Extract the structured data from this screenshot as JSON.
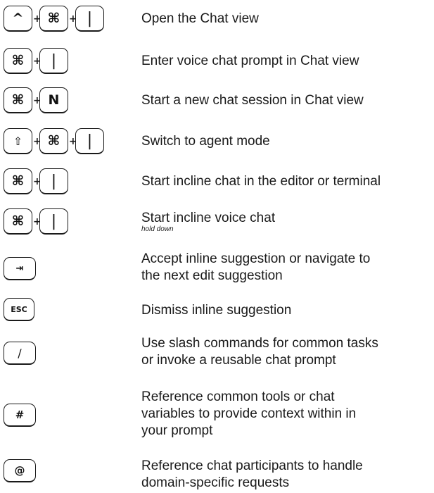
{
  "shortcuts": [
    {
      "keys": [
        "^",
        "⌘",
        "|"
      ],
      "description": "Open the Chat view"
    },
    {
      "keys": [
        "⌘",
        "|"
      ],
      "description": "Enter voice chat prompt in Chat view"
    },
    {
      "keys": [
        "⌘",
        "N"
      ],
      "description": "Start a new chat session in Chat view"
    },
    {
      "keys": [
        "⇧",
        "⌘",
        "|"
      ],
      "description": "Switch to agent mode"
    },
    {
      "keys": [
        "⌘",
        "|"
      ],
      "description": "Start incline chat in the editor or terminal"
    },
    {
      "keys": [
        "⌘",
        "|"
      ],
      "description": "Start incline voice chat",
      "note": "hold down"
    },
    {
      "keys": [
        "⇥"
      ],
      "description_line1": "Accept inline suggestion or navigate to",
      "description_line2": "the next edit suggestion"
    },
    {
      "keys": [
        "ESC"
      ],
      "description": "Dismiss inline suggestion"
    },
    {
      "keys": [
        "/"
      ],
      "description_line1": "Use slash commands for common tasks",
      "description_line2": "or invoke a reusable chat prompt"
    },
    {
      "keys": [
        "#"
      ],
      "description_line1": "Reference common tools or chat",
      "description_line2": "variables to provide context within in",
      "description_line3": "your prompt"
    },
    {
      "keys": [
        "@"
      ],
      "description_line1": "Reference chat participants to handle",
      "description_line2": "domain-specific requests"
    }
  ],
  "plus_sign": "+"
}
